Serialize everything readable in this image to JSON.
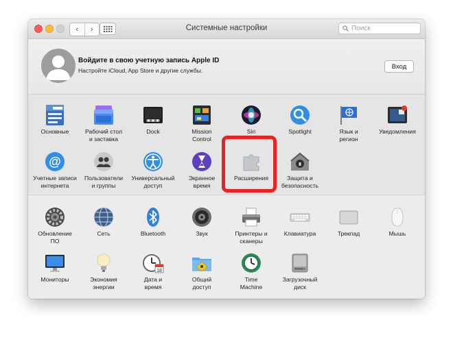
{
  "window": {
    "title": "Системные настройки",
    "search_placeholder": "Поиск",
    "nav_back_glyph": "‹",
    "nav_forward_glyph": "›"
  },
  "apple_id": {
    "title": "Войдите в свою учетную запись Apple ID",
    "subtitle": "Настройте iCloud, App Store и другие службы.",
    "button": "Вход"
  },
  "prefs_row1": [
    {
      "label": "Основные",
      "icon": "general-icon"
    },
    {
      "label": "Рабочий стол\nи заставка",
      "icon": "desktop-icon"
    },
    {
      "label": "Dock",
      "icon": "dock-icon"
    },
    {
      "label": "Mission\nControl",
      "icon": "mission-control-icon"
    },
    {
      "label": "Siri",
      "icon": "siri-icon"
    },
    {
      "label": "Spotlight",
      "icon": "spotlight-icon"
    },
    {
      "label": "Язык и\nрегион",
      "icon": "flag-icon"
    },
    {
      "label": "Уведомления",
      "icon": "notifications-icon"
    }
  ],
  "prefs_row2": [
    {
      "label": "Учетные записи\nинтернета",
      "icon": "at-icon"
    },
    {
      "label": "Пользователи\nи группы",
      "icon": "users-icon"
    },
    {
      "label": "Универсальный\nдоступ",
      "icon": "accessibility-icon"
    },
    {
      "label": "Экранное\nвремя",
      "icon": "hourglass-icon"
    },
    {
      "label": "Расширения",
      "icon": "puzzle-icon"
    },
    {
      "label": "Защита и\nбезопасность",
      "icon": "house-lock-icon"
    }
  ],
  "prefs_row3": [
    {
      "label": "Обновление\nПО",
      "icon": "gear-icon"
    },
    {
      "label": "Сеть",
      "icon": "globe-icon"
    },
    {
      "label": "Bluetooth",
      "icon": "bluetooth-icon"
    },
    {
      "label": "Звук",
      "icon": "speaker-icon"
    },
    {
      "label": "Принтеры и\nсканеры",
      "icon": "printer-icon"
    },
    {
      "label": "Клавиатура",
      "icon": "keyboard-icon"
    },
    {
      "label": "Трекпад",
      "icon": "trackpad-icon"
    },
    {
      "label": "Мышь",
      "icon": "mouse-icon"
    }
  ],
  "prefs_row4": [
    {
      "label": "Мониторы",
      "icon": "monitor-icon"
    },
    {
      "label": "Экономия\nэнергии",
      "icon": "lightbulb-icon"
    },
    {
      "label": "Дата и\nвремя",
      "icon": "clock-calendar-icon"
    },
    {
      "label": "Общий\nдоступ",
      "icon": "sharing-folder-icon"
    },
    {
      "label": "Time\nMachine",
      "icon": "time-machine-icon"
    },
    {
      "label": "Загрузочный\nдиск",
      "icon": "disk-icon"
    }
  ],
  "highlighted_item": "Расширения",
  "colors": {
    "highlight": "#ea2226",
    "close": "#fc605c",
    "minimize": "#fdbc40",
    "section_top": "#e5e5e5",
    "section_bottom": "#ececec"
  }
}
